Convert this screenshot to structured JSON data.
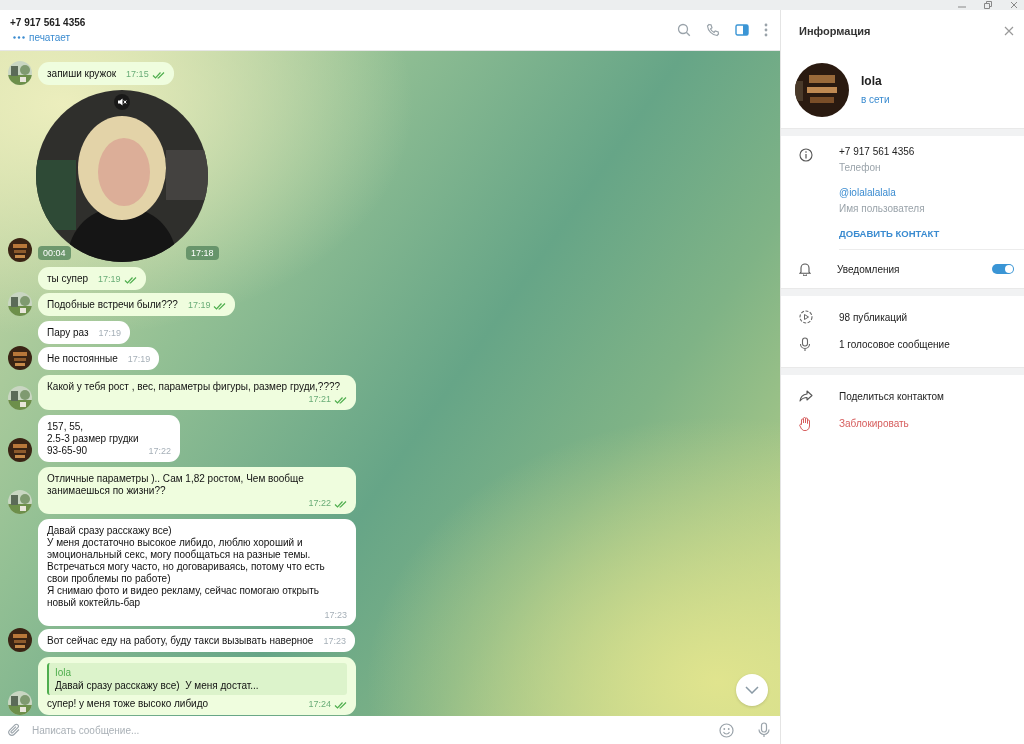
{
  "chat_header": {
    "title": "+7 917 561 4356",
    "status": "печатает"
  },
  "toolbar": [
    {
      "kind": "search",
      "selected": false
    },
    {
      "kind": "call",
      "selected": false
    },
    {
      "kind": "sidebar",
      "selected": true
    },
    {
      "kind": "more",
      "selected": false
    }
  ],
  "messages": [
    {
      "kind": "text",
      "out": true,
      "text": "запиши кружок",
      "time": "17:15",
      "read": true,
      "avatar": true
    },
    {
      "kind": "video",
      "out": false,
      "duration": "00:04",
      "time": "17:18",
      "muted": true,
      "avatar": true
    },
    {
      "kind": "text",
      "out": true,
      "text": "ты супер",
      "time": "17:19",
      "read": true,
      "avatar": false
    },
    {
      "kind": "text",
      "out": true,
      "text": "Подобные встречи были???",
      "time": "17:19",
      "read": true,
      "avatar": true
    },
    {
      "kind": "text",
      "out": false,
      "text": "Пару раз",
      "time": "17:19",
      "avatar": false
    },
    {
      "kind": "text",
      "out": false,
      "text": "Не постоянные",
      "time": "17:19",
      "avatar": true
    },
    {
      "kind": "text",
      "out": true,
      "text": "Какой у тебя рост , вес, параметры фигуры, размер груди,????",
      "time": "17:21",
      "read": true,
      "avatar": true
    },
    {
      "kind": "text",
      "out": false,
      "text": "157, 55,\n2.5-3 размер грудки\n93-65-90",
      "time": "17:22",
      "avatar": true
    },
    {
      "kind": "text",
      "out": true,
      "text": "Отличные параметры ).. Сам 1,82 ростом, Чем вообще занимаешься по жизни??",
      "time": "17:22",
      "read": true,
      "avatar": true
    },
    {
      "kind": "text",
      "out": false,
      "text": "Давай сразу расскажу все)\nУ меня достаточно высокое либидо, люблю хороший и эмоциональный секс, могу пообщаться на разные темы.\nВстречаться могу часто, но договариваясь, потому что есть свои проблемы по работе)\nЯ снимаю фото и видео рекламу, сейчас помогаю открыть новый коктейль-бар",
      "time": "17:23",
      "avatar": false
    },
    {
      "kind": "text",
      "out": false,
      "text": "Вот сейчас еду на работу, буду такси вызывать наверное",
      "time": "17:23",
      "avatar": true
    },
    {
      "kind": "reply",
      "out": true,
      "quote_author": "Iola",
      "quote_text": "Давай сразу расскажу все)  У меня достат...",
      "text": "супер! у меня тоже высоко либидо",
      "time": "17:24",
      "read": true,
      "avatar": true
    }
  ],
  "composer": {
    "placeholder": "Написать сообщение..."
  },
  "info_panel": {
    "title": "Информация",
    "name": "Iola",
    "status": "в сети",
    "phone": "+7 917 561 4356",
    "phone_label": "Телефон",
    "username": "@iolalalalala",
    "username_label": "Имя пользователя",
    "add_contact": "ДОБАВИТЬ КОНТАКТ",
    "notifications": {
      "label": "Уведомления",
      "on": true
    },
    "media": [
      {
        "kind": "posts",
        "label": "98 публикаций"
      },
      {
        "kind": "voice",
        "label": "1 голосовое сообщение"
      }
    ],
    "actions": [
      {
        "kind": "share",
        "label": "Поделиться контактом"
      },
      {
        "kind": "block",
        "label": "Заблокировать"
      }
    ]
  }
}
